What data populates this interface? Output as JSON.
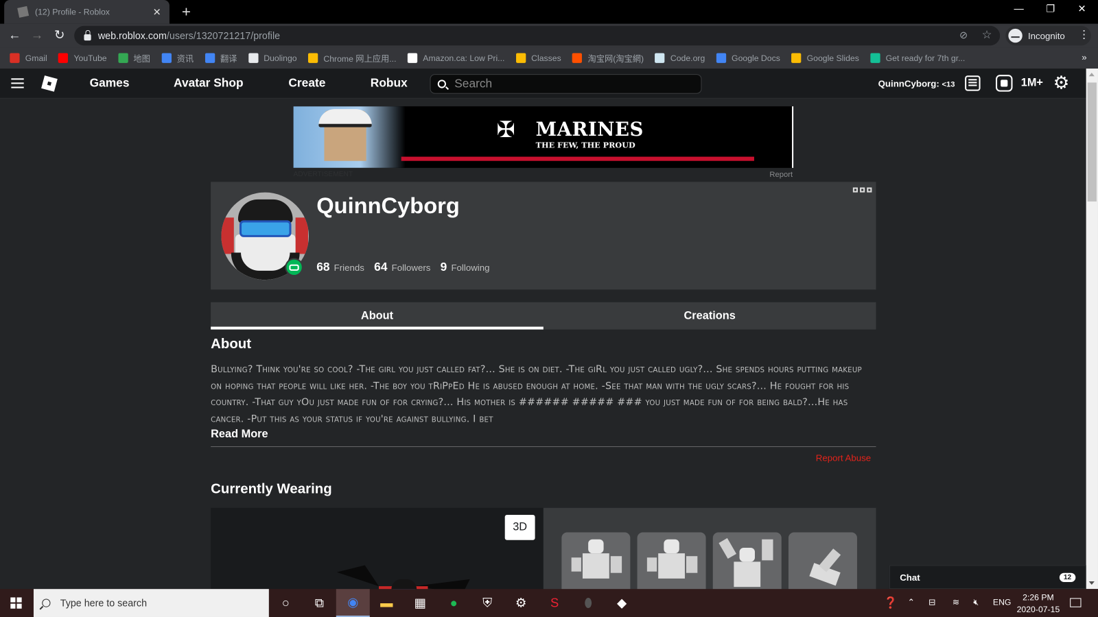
{
  "browser": {
    "tab_title": "(12) Profile - Roblox",
    "url_host": "web.roblox.com",
    "url_path": "/users/1320721217/profile",
    "profile_label": "Incognito",
    "bookmarks": [
      {
        "label": "Gmail",
        "color": "#d93025"
      },
      {
        "label": "YouTube",
        "color": "#ff0000"
      },
      {
        "label": "地图",
        "color": "#34a853"
      },
      {
        "label": "资讯",
        "color": "#4285f4"
      },
      {
        "label": "翻译",
        "color": "#4285f4"
      },
      {
        "label": "Duolingo",
        "color": "#e8eaed"
      },
      {
        "label": "Chrome 网上应用...",
        "color": "#fbbc04"
      },
      {
        "label": "Amazon.ca: Low Pri...",
        "color": "#ffffff"
      },
      {
        "label": "Classes",
        "color": "#fbbc04"
      },
      {
        "label": "淘宝网(淘宝網)",
        "color": "#ff5000"
      },
      {
        "label": "Code.org",
        "color": "#cfe6f1"
      },
      {
        "label": "Google Docs",
        "color": "#4285f4"
      },
      {
        "label": "Google Slides",
        "color": "#fbbc04"
      },
      {
        "label": "Get ready for 7th gr...",
        "color": "#14bf96"
      }
    ]
  },
  "header": {
    "nav": [
      "Games",
      "Avatar Shop",
      "Create",
      "Robux"
    ],
    "search_placeholder": "Search",
    "username": "QuinnCyborg:",
    "age_label": "<13",
    "robux": "1M+"
  },
  "ad": {
    "title": "MARINES",
    "subtitle": "THE FEW, THE PROUD",
    "label": "ADVERTISEMENT",
    "report": "Report"
  },
  "profile": {
    "name": "QuinnCyborg",
    "friends_count": "68",
    "friends_label": "Friends",
    "followers_count": "64",
    "followers_label": "Followers",
    "following_count": "9",
    "following_label": "Following",
    "status": "in-game",
    "status_color": "#02b757"
  },
  "tabs": [
    {
      "label": "About",
      "active": true
    },
    {
      "label": "Creations",
      "active": false
    }
  ],
  "about": {
    "heading": "About",
    "text": "Bullying? Think you're so cool? -The girl you just called fat?... She is on diet. -The giRl you just called ugly?... She spends hours putting makeup on hoping that people will like her. -The boy you tRiPpEd He is abused enough at home. -See that man with the ugly scars?... He fought for his country. -That guy yOu just made fun of for crying?... His mother is ###### ##### ### you just made fun of for being bald?...He has cancer. -Put this as your status if you're against bullying. I bet",
    "read_more": "Read More",
    "report_abuse": "Report Abuse"
  },
  "wearing": {
    "heading": "Currently Wearing",
    "view_toggle": "3D",
    "items": [
      "emote-1",
      "emote-2",
      "emote-3",
      "emote-4"
    ]
  },
  "chat": {
    "label": "Chat",
    "unread": "12"
  },
  "taskbar": {
    "search_placeholder": "Type here to search",
    "language": "ENG",
    "time": "2:26 PM",
    "date": "2020-07-15"
  }
}
